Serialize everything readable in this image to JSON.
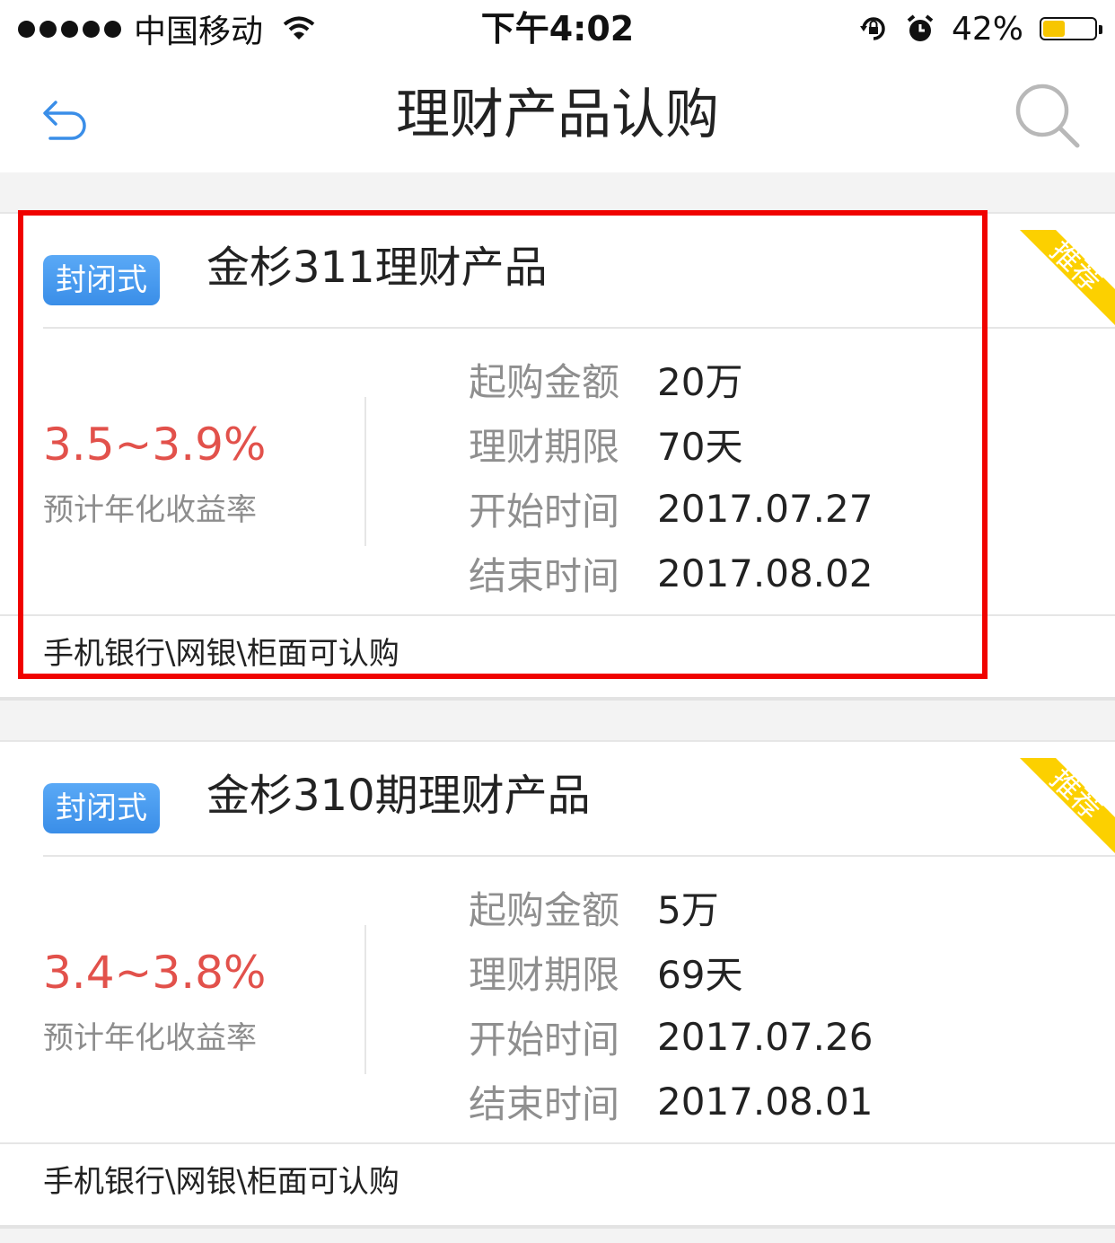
{
  "status_bar": {
    "carrier": "中国移动",
    "time": "下午4:02",
    "battery_percent": "42%",
    "battery_level": 0.42,
    "icons": [
      "signal-dots-icon",
      "wifi-icon",
      "rotation-lock-icon",
      "alarm-icon",
      "battery-icon"
    ]
  },
  "nav": {
    "title": "理财产品认购",
    "back_icon": "back-arrow-icon",
    "search_icon": "search-icon"
  },
  "colors": {
    "tag_blue": "#3a8ee8",
    "rate_red": "#e2514b",
    "ribbon_yellow": "#fcd000",
    "highlight_red": "#f00200"
  },
  "products": [
    {
      "tag": "封闭式",
      "name": "金杉311理财产品",
      "ribbon": "推荐",
      "rate": "3.5~3.9%",
      "rate_label": "预计年化收益率",
      "details": [
        {
          "label": "起购金额",
          "value": "20万"
        },
        {
          "label": "理财期限",
          "value": "70天"
        },
        {
          "label": "开始时间",
          "value": "2017.07.27"
        },
        {
          "label": "结束时间",
          "value": "2017.08.02"
        }
      ],
      "channels": "手机银行\\网银\\柜面可认购"
    },
    {
      "tag": "封闭式",
      "name": "金杉310期理财产品",
      "ribbon": "推荐",
      "rate": "3.4~3.8%",
      "rate_label": "预计年化收益率",
      "details": [
        {
          "label": "起购金额",
          "value": "5万"
        },
        {
          "label": "理财期限",
          "value": "69天"
        },
        {
          "label": "开始时间",
          "value": "2017.07.26"
        },
        {
          "label": "结束时间",
          "value": "2017.08.01"
        }
      ],
      "channels": "手机银行\\网银\\柜面可认购"
    }
  ]
}
